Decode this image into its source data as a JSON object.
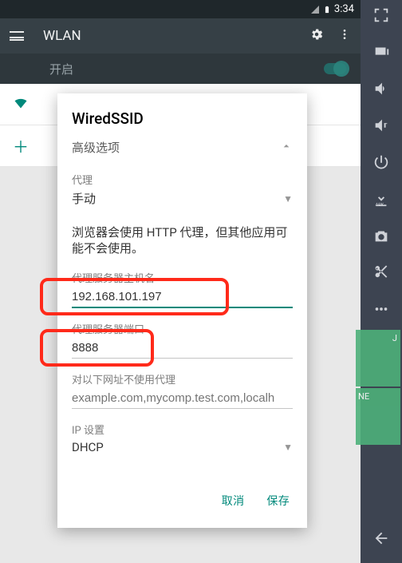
{
  "statusbar": {
    "time": "3:34"
  },
  "toolbar": {
    "title": "WLAN"
  },
  "master_toggle": {
    "label": "开启"
  },
  "list": {
    "current_ssid": "WiredSSID"
  },
  "dialog": {
    "title": "WiredSSID",
    "advanced_label": "高级选项",
    "proxy_label": "代理",
    "proxy_value": "手动",
    "note": "浏览器会使用 HTTP 代理，但其他应用可能不会使用。",
    "host_label": "代理服务器主机名",
    "host_value": "192.168.101.197",
    "port_label": "代理服务器端口",
    "port_value": "8888",
    "bypass_label": "对以下网址不使用代理",
    "bypass_placeholder": "example.com,mycomp.test.com,localh",
    "ip_label": "IP 设置",
    "ip_value": "DHCP",
    "cancel": "取消",
    "save": "保存"
  },
  "sidebar_overlay": {
    "label1": "J",
    "label2": "NE"
  }
}
